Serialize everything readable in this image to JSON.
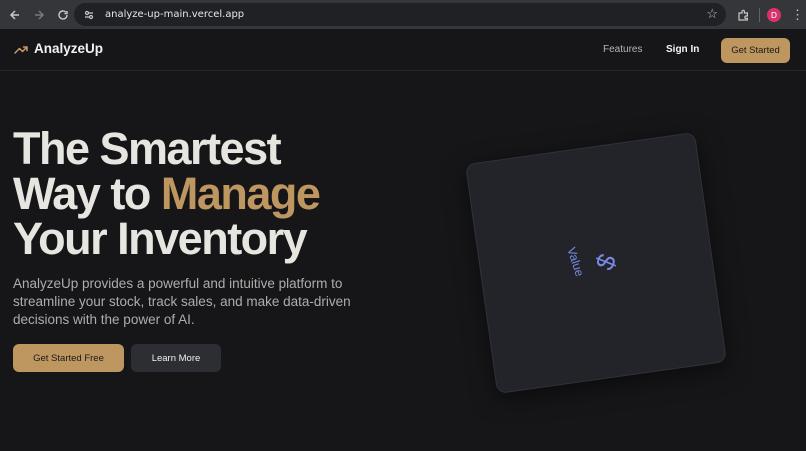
{
  "browser": {
    "url": "analyze-up-main.vercel.app",
    "avatar_letter": "D",
    "back_icon": "back-arrow-icon",
    "forward_icon": "forward-arrow-icon",
    "reload_icon": "reload-icon"
  },
  "header": {
    "brand": "AnalyzeUp",
    "nav": {
      "features": "Features",
      "signin": "Sign In",
      "cta": "Get Started"
    }
  },
  "hero": {
    "title_line1": "The Smartest",
    "title_line2_a": "Way to ",
    "title_line2_b": "Manage",
    "title_line3": "Your Inventory",
    "description": "AnalyzeUp provides a powerful and intuitive platform to streamline your stock, track sales, and make data-driven decisions with the power of AI.",
    "primary_button": "Get Started Free",
    "secondary_button": "Learn More"
  },
  "card": {
    "symbol": "$",
    "label": "Value"
  },
  "colors": {
    "accent": "#be9660",
    "background": "#161619",
    "card_text": "#7a8ae6"
  }
}
